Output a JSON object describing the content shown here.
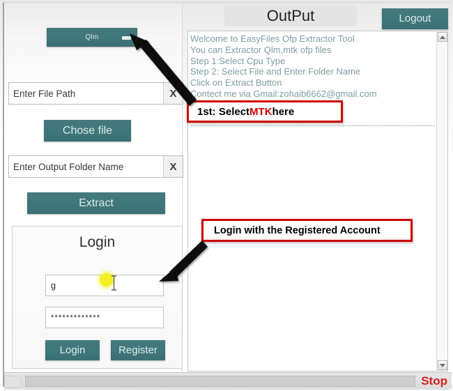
{
  "window": {
    "left_panel": {
      "cpu_combo": {
        "value": "Qlm",
        "icon": "chevron-down-icon"
      },
      "file_path_input": {
        "value": "Enter File Path",
        "clear_label": "X"
      },
      "chose_file_button": "Chose file",
      "output_folder_input": {
        "value": "Enter Output Folder Name",
        "clear_label": "X"
      },
      "extract_button": "Extract",
      "login_group": {
        "title": "Login",
        "username": "g",
        "password_masked": "*************",
        "login_button": "Login",
        "register_button": "Register"
      }
    },
    "right_panel": {
      "title": "OutPut",
      "logout_button": "Logout",
      "console_lines": [
        "Welcome to EasyFiles Ofp Extractor Tool",
        "You can Extractor Qlm,mtk ofp files",
        "Step 1:Select Cpu Type",
        "Step 2: Select File and Enter Folder Name",
        "Click on Extract Button",
        "Contect me via Gmail:zohaib6662@gmail.com"
      ],
      "scrollbar": {
        "up_icon": "scroll-up-arrow-icon",
        "down_icon": "scroll-down-arrow-icon"
      }
    },
    "annotations": {
      "mtk": {
        "prefix": "1st: Select ",
        "highlight": "MTK",
        "suffix": " here"
      },
      "login": "Login with the Registered Account"
    },
    "status_bar": {
      "stop_label": "Stop",
      "progress_value": ""
    }
  },
  "colors": {
    "teal": "#3f777a",
    "annotation_red": "#cc0000",
    "highlight_red": "#d40000",
    "console_text": "#7d9ea2",
    "stop_red": "#d42020",
    "cursor_highlight": "#f2ef22"
  }
}
